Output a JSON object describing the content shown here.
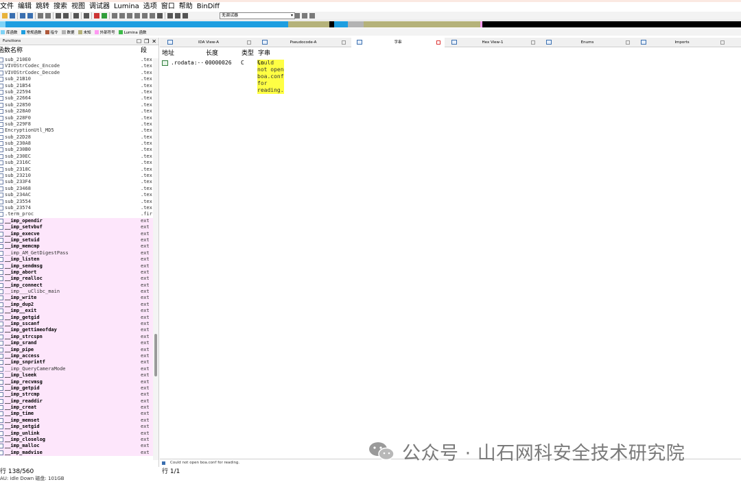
{
  "menu": [
    "文件",
    "编辑",
    "跳转",
    "搜索",
    "视图",
    "调试器",
    "Lumina",
    "选项",
    "窗口",
    "帮助",
    "BinDiff"
  ],
  "toolbar": {
    "debugger_select": "无调试器"
  },
  "legend": [
    {
      "label": "库函数",
      "color": "#7fd3f7"
    },
    {
      "label": "常规函数",
      "color": "#1e9ee0"
    },
    {
      "label": "指令",
      "color": "#b05a3c"
    },
    {
      "label": "数据",
      "color": "#b3b3b3"
    },
    {
      "label": "未知",
      "color": "#b5b27a"
    },
    {
      "label": "外部符号",
      "color": "#ff9af2"
    },
    {
      "label": "Lumina 函数",
      "color": "#3dbb49"
    }
  ],
  "functions_panel": {
    "title": "Functions",
    "col_name": "函数名称",
    "col_segment": "段",
    "rows": [
      {
        "name": "sub_210E0",
        "seg": ".tex",
        "imp": false
      },
      {
        "name": "VIVOStrCodec_Encode",
        "seg": ".tex",
        "imp": false
      },
      {
        "name": "VIVOStrCodec_Decode",
        "seg": ".tex",
        "imp": false
      },
      {
        "name": "sub_21B10",
        "seg": ".tex",
        "imp": false
      },
      {
        "name": "sub_21B54",
        "seg": ".tex",
        "imp": false
      },
      {
        "name": "sub_22594",
        "seg": ".tex",
        "imp": false
      },
      {
        "name": "sub_22664",
        "seg": ".tex",
        "imp": false
      },
      {
        "name": "sub_22850",
        "seg": ".tex",
        "imp": false
      },
      {
        "name": "sub_228A0",
        "seg": ".tex",
        "imp": false
      },
      {
        "name": "sub_228F0",
        "seg": ".tex",
        "imp": false
      },
      {
        "name": "sub_229F8",
        "seg": ".tex",
        "imp": false
      },
      {
        "name": "EncryptionUtl_MD5",
        "seg": ".tex",
        "imp": false
      },
      {
        "name": "sub_22D28",
        "seg": ".tex",
        "imp": false
      },
      {
        "name": "sub_230A8",
        "seg": ".tex",
        "imp": false
      },
      {
        "name": "sub_230B0",
        "seg": ".tex",
        "imp": false
      },
      {
        "name": "sub_230EC",
        "seg": ".tex",
        "imp": false
      },
      {
        "name": "sub_2316C",
        "seg": ".tex",
        "imp": false
      },
      {
        "name": "sub_2318C",
        "seg": ".tex",
        "imp": false
      },
      {
        "name": "sub_23210",
        "seg": ".tex",
        "imp": false
      },
      {
        "name": "sub_233F4",
        "seg": ".tex",
        "imp": false
      },
      {
        "name": "sub_23468",
        "seg": ".tex",
        "imp": false
      },
      {
        "name": "sub_234AC",
        "seg": ".tex",
        "imp": false
      },
      {
        "name": "sub_23554",
        "seg": ".tex",
        "imp": false
      },
      {
        "name": "sub_23574",
        "seg": ".tex",
        "imp": false
      },
      {
        "name": ".term_proc",
        "seg": ".fir",
        "imp": false
      },
      {
        "name": "__imp_opendir",
        "seg": "ext",
        "imp": true,
        "bold": true
      },
      {
        "name": "__imp_setvbuf",
        "seg": "ext",
        "imp": true,
        "bold": true
      },
      {
        "name": "__imp_execve",
        "seg": "ext",
        "imp": true,
        "bold": true
      },
      {
        "name": "__imp_setuid",
        "seg": "ext",
        "imp": true,
        "bold": true
      },
      {
        "name": "__imp_memcmp",
        "seg": "ext",
        "imp": true,
        "bold": true
      },
      {
        "name": "__imp_AM_GetDigestPass",
        "seg": "ext",
        "imp": true,
        "bold": false
      },
      {
        "name": "__imp_listen",
        "seg": "ext",
        "imp": true,
        "bold": true
      },
      {
        "name": "__imp_sendmsg",
        "seg": "ext",
        "imp": true,
        "bold": true
      },
      {
        "name": "__imp_abort",
        "seg": "ext",
        "imp": true,
        "bold": true
      },
      {
        "name": "__imp_realloc",
        "seg": "ext",
        "imp": true,
        "bold": true
      },
      {
        "name": "__imp_connect",
        "seg": "ext",
        "imp": true,
        "bold": true
      },
      {
        "name": "__imp___uClibc_main",
        "seg": "ext",
        "imp": true,
        "bold": false
      },
      {
        "name": "__imp_write",
        "seg": "ext",
        "imp": true,
        "bold": true
      },
      {
        "name": "__imp_dup2",
        "seg": "ext",
        "imp": true,
        "bold": true
      },
      {
        "name": "__imp__exit",
        "seg": "ext",
        "imp": true,
        "bold": true
      },
      {
        "name": "__imp_getgid",
        "seg": "ext",
        "imp": true,
        "bold": true
      },
      {
        "name": "__imp_sscanf",
        "seg": "ext",
        "imp": true,
        "bold": true
      },
      {
        "name": "__imp_gettimeofday",
        "seg": "ext",
        "imp": true,
        "bold": true
      },
      {
        "name": "__imp_strcspn",
        "seg": "ext",
        "imp": true,
        "bold": true
      },
      {
        "name": "__imp_srand",
        "seg": "ext",
        "imp": true,
        "bold": true
      },
      {
        "name": "__imp_pipe",
        "seg": "ext",
        "imp": true,
        "bold": true
      },
      {
        "name": "__imp_access",
        "seg": "ext",
        "imp": true,
        "bold": true
      },
      {
        "name": "__imp_snprintf",
        "seg": "ext",
        "imp": true,
        "bold": true
      },
      {
        "name": "__imp_QueryCameraMode",
        "seg": "ext",
        "imp": true,
        "bold": false
      },
      {
        "name": "__imp_lseek",
        "seg": "ext",
        "imp": true,
        "bold": true
      },
      {
        "name": "__imp_recvmsg",
        "seg": "ext",
        "imp": true,
        "bold": true
      },
      {
        "name": "__imp_getpid",
        "seg": "ext",
        "imp": true,
        "bold": true
      },
      {
        "name": "__imp_strcmp",
        "seg": "ext",
        "imp": true,
        "bold": true
      },
      {
        "name": "__imp_readdir",
        "seg": "ext",
        "imp": true,
        "bold": true
      },
      {
        "name": "__imp_creat",
        "seg": "ext",
        "imp": true,
        "bold": true
      },
      {
        "name": "__imp_time",
        "seg": "ext",
        "imp": true,
        "bold": true
      },
      {
        "name": "__imp_memset",
        "seg": "ext",
        "imp": true,
        "bold": true
      },
      {
        "name": "__imp_setgid",
        "seg": "ext",
        "imp": true,
        "bold": true
      },
      {
        "name": "__imp_unlink",
        "seg": "ext",
        "imp": true,
        "bold": true
      },
      {
        "name": "__imp_closelog",
        "seg": "ext",
        "imp": true,
        "bold": true
      },
      {
        "name": "__imp_malloc",
        "seg": "ext",
        "imp": true,
        "bold": true
      },
      {
        "name": "__imp_madvise",
        "seg": "ext",
        "imp": true,
        "bold": true
      }
    ],
    "status": "行 138/560"
  },
  "tabs": [
    {
      "label": "IDA View-A",
      "active": false
    },
    {
      "label": "Pseudocode-A",
      "active": false
    },
    {
      "label": "字串",
      "active": true
    },
    {
      "label": "Hex View-1",
      "active": false
    },
    {
      "label": "Enums",
      "active": false
    },
    {
      "label": "Imports",
      "active": false
    }
  ],
  "strings_view": {
    "col_address": "地址",
    "col_length": "长度",
    "col_type": "类型",
    "col_string": "字串",
    "row": {
      "address": ".rodata:···",
      "length": "00000026",
      "type": "C",
      "string_highlight": "Could not open boa.conf for reading.",
      "string_rest": "\\n"
    },
    "bottom_text": "Could not open boa.conf for reading.",
    "status": "行 1/1"
  },
  "bottom_status": "AU:   idle    Down    磁盘: 101GB",
  "watermark": "公众号 · 山石网科安全技术研究院"
}
